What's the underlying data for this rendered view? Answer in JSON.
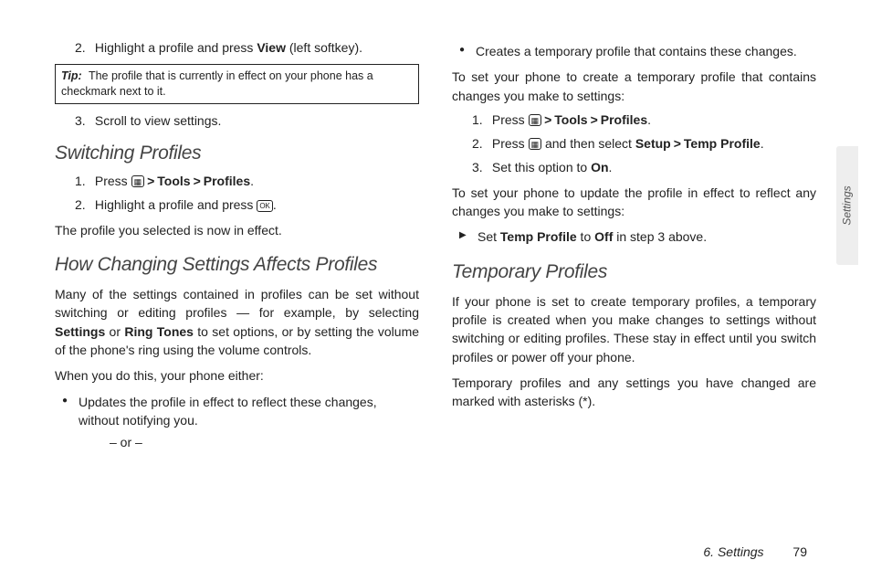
{
  "col1": {
    "step2_a": "Highlight a profile and press ",
    "step2_b": "View",
    "step2_c": "  (left softkey).",
    "tip_label": "Tip:",
    "tip_text": "The profile that is currently in effect on your phone has a checkmark next to it.",
    "step3": "Scroll to view settings.",
    "h_switching": "Switching Profiles",
    "sw_step1_a": "Press ",
    "sw_step1_tools": "Tools",
    "sw_step1_profiles": "Profiles",
    "sw_step2_a": "Highlight a profile and press ",
    "sw_result": "The profile you selected is now in effect.",
    "h_changing": "How Changing Settings Affects Profiles",
    "chg_p1_a": "Many of the settings contained in profiles can be set without switching or editing profiles — for example, by selecting ",
    "chg_p1_settings": "Settings",
    "chg_p1_or": " or ",
    "chg_p1_ring": "Ring Tones",
    "chg_p1_b": " to set options, or by setting the volume of the phone's ring using the volume controls.",
    "chg_p2": "When you do this, your phone either:",
    "chg_b1": "Updates the profile in effect to reflect these changes, without notifying you.",
    "or": "– or –"
  },
  "col2": {
    "b_creates": "Creates a temporary profile that contains these changes.",
    "p_toset1": "To set your phone to create a temporary profile that contains changes you make to settings:",
    "s1_press": "Press ",
    "s1_tools": "Tools",
    "s1_profiles": "Profiles",
    "s2_press": "Press ",
    "s2_and": " and then select ",
    "s2_setup": "Setup",
    "s2_temp": "Temp Profile",
    "s3_a": "Set this option to ",
    "s3_on": "On",
    "p_toset2": "To set your phone to update the profile in effect to reflect any changes you make to settings:",
    "ab_a": "Set ",
    "ab_temp": "Temp Profile",
    "ab_b": " to ",
    "ab_off": "Off",
    "ab_c": " in step 3 above.",
    "h_temp": "Temporary Profiles",
    "tp_p1": "If your phone is set to create temporary profiles, a temporary profile is created when you make changes to settings without switching or editing profiles. These stay in effect until you switch profiles or power off your phone.",
    "tp_p2": "Temporary profiles and any settings you have changed are marked with asterisks (*)."
  },
  "icons": {
    "menu": "▦",
    "ok": "OK"
  },
  "side_tab": "Settings",
  "footer": {
    "chapter": "6. Settings",
    "page": "79"
  },
  "gt": ">"
}
